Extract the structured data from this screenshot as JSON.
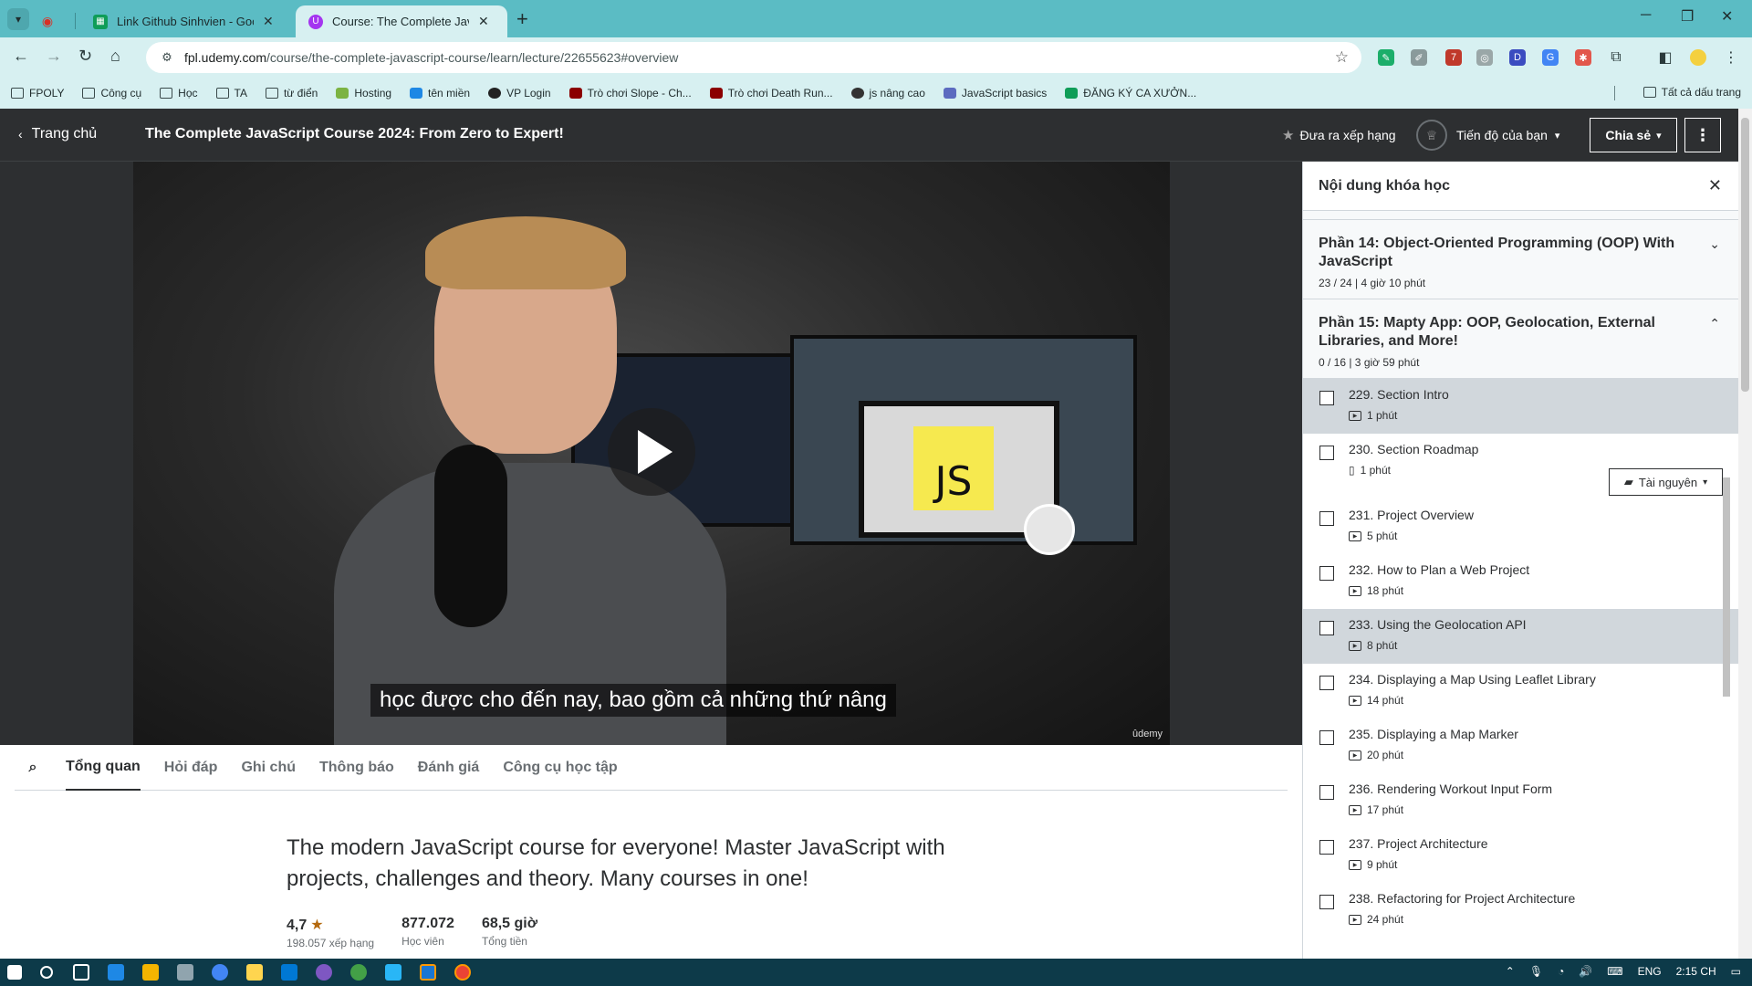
{
  "browser": {
    "tabs": [
      {
        "title": "Link Github Sinhvien - Google Tr",
        "favicon_color": "#0f9d58"
      },
      {
        "title": "Course: The Complete JavaScript",
        "favicon_color": "#a435f0"
      }
    ],
    "url_host": "fpl.udemy.com",
    "url_path": "/course/the-complete-javascript-course/learn/lecture/22655623#overview",
    "bookmarks": [
      "FPOLY",
      "Công cụ",
      "Học",
      "TA",
      "từ điển",
      "Hosting",
      "tên miền",
      "VP Login",
      "Trò chơi Slope - Ch...",
      "Trò chơi Death Run...",
      "js nâng cao",
      "JavaScript basics",
      "ĐĂNG KÝ CA XƯỞN..."
    ],
    "bookmarks_all": "Tất cả dấu trang"
  },
  "header": {
    "home": "Trang chủ",
    "course_title": "The Complete JavaScript Course 2024: From Zero to Expert!",
    "rate": "Đưa ra xếp hạng",
    "progress": "Tiến độ của bạn",
    "share": "Chia sẻ"
  },
  "video": {
    "caption": "học được cho đến nay, bao gồm cả những thứ nâng",
    "note_text": "JS",
    "watermark": "ûdemy"
  },
  "tabs": [
    "Tổng quan",
    "Hỏi đáp",
    "Ghi chú",
    "Thông báo",
    "Đánh giá",
    "Công cụ học tập"
  ],
  "overview": {
    "headline": "The modern JavaScript course for everyone! Master JavaScript with projects, challenges and theory. Many courses in one!",
    "rating": "4,7",
    "rating_label": "198.057 xếp hạng",
    "students": "877.072",
    "students_label": "Học viên",
    "hours": "68,5 giờ",
    "hours_label": "Tổng tiền"
  },
  "sidebar": {
    "title": "Nội dung khóa học",
    "sections": [
      {
        "title": "Phần 14: Object-Oriented Programming (OOP) With JavaScript",
        "meta": "23 / 24 | 4 giờ 10 phút"
      },
      {
        "title": "Phần 15: Mapty App: OOP, Geolocation, External Libraries, and More!",
        "meta": "0 / 16 | 3 giờ 59 phút"
      }
    ],
    "lessons": [
      {
        "name": "229. Section Intro",
        "duration": "1 phút",
        "type": "video",
        "highlighted": true
      },
      {
        "name": "230. Section Roadmap",
        "duration": "1 phút",
        "type": "doc",
        "highlighted": false,
        "resources": "Tài nguyên"
      },
      {
        "name": "231. Project Overview",
        "duration": "5 phút",
        "type": "video",
        "highlighted": false
      },
      {
        "name": "232. How to Plan a Web Project",
        "duration": "18 phút",
        "type": "video",
        "highlighted": false
      },
      {
        "name": "233. Using the Geolocation API",
        "duration": "8 phút",
        "type": "video",
        "highlighted": true
      },
      {
        "name": "234. Displaying a Map Using Leaflet Library",
        "duration": "14 phút",
        "type": "video",
        "highlighted": false
      },
      {
        "name": "235. Displaying a Map Marker",
        "duration": "20 phút",
        "type": "video",
        "highlighted": false
      },
      {
        "name": "236. Rendering Workout Input Form",
        "duration": "17 phút",
        "type": "video",
        "highlighted": false
      },
      {
        "name": "237. Project Architecture",
        "duration": "9 phút",
        "type": "video",
        "highlighted": false
      },
      {
        "name": "238. Refactoring for Project Architecture",
        "duration": "24 phút",
        "type": "video",
        "highlighted": false
      }
    ]
  },
  "taskbar": {
    "language": "ENG",
    "time": "2:15 CH"
  }
}
